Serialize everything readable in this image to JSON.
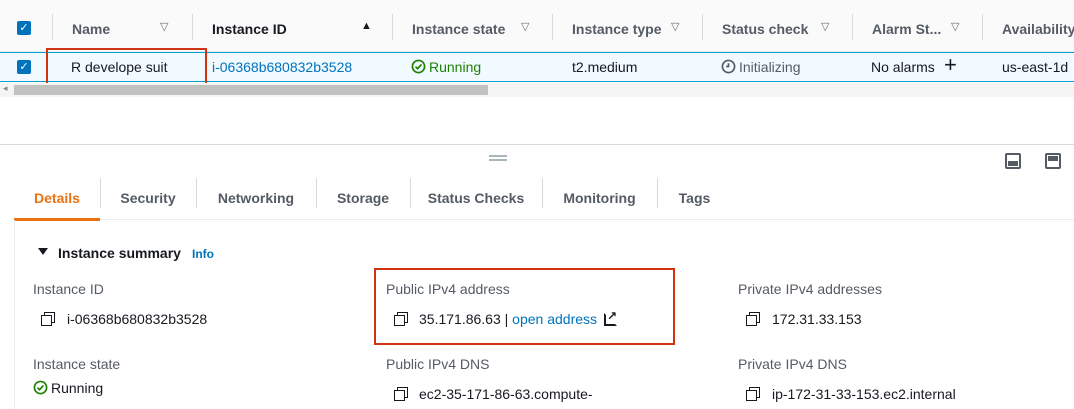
{
  "table": {
    "headers": {
      "name": "Name",
      "instance_id": "Instance ID",
      "instance_state": "Instance state",
      "instance_type": "Instance type",
      "status_check": "Status check",
      "alarm_status": "Alarm St...",
      "availability": "Availability"
    },
    "row": {
      "name": "R develope suit",
      "instance_id": "i-06368b680832b3528",
      "instance_state": "Running",
      "instance_type": "t2.medium",
      "status_check": "Initializing",
      "alarm_status": "No alarms",
      "availability_zone": "us-east-1d"
    }
  },
  "tabs": [
    "Details",
    "Security",
    "Networking",
    "Storage",
    "Status Checks",
    "Monitoring",
    "Tags"
  ],
  "summary": {
    "title": "Instance summary",
    "info": "Info",
    "instance_id_label": "Instance ID",
    "instance_id_value": "i-06368b680832b3528",
    "public_ipv4_label": "Public IPv4 address",
    "public_ipv4_value": "35.171.86.63",
    "public_ipv4_sep": "|",
    "open_address": "open address",
    "private_ipv4_label": "Private IPv4 addresses",
    "private_ipv4_value": "172.31.33.153",
    "instance_state_label": "Instance state",
    "instance_state_value": "Running",
    "public_dns_label": "Public IPv4 DNS",
    "public_dns_value": "ec2-35-171-86-63.compute-",
    "private_dns_label": "Private IPv4 DNS",
    "private_dns_value": "ip-172-31-33-153.ec2.internal"
  },
  "colors": {
    "accent": "#ec7211",
    "link": "#0073bb",
    "success": "#1d8102",
    "highlight": "#d13212"
  }
}
